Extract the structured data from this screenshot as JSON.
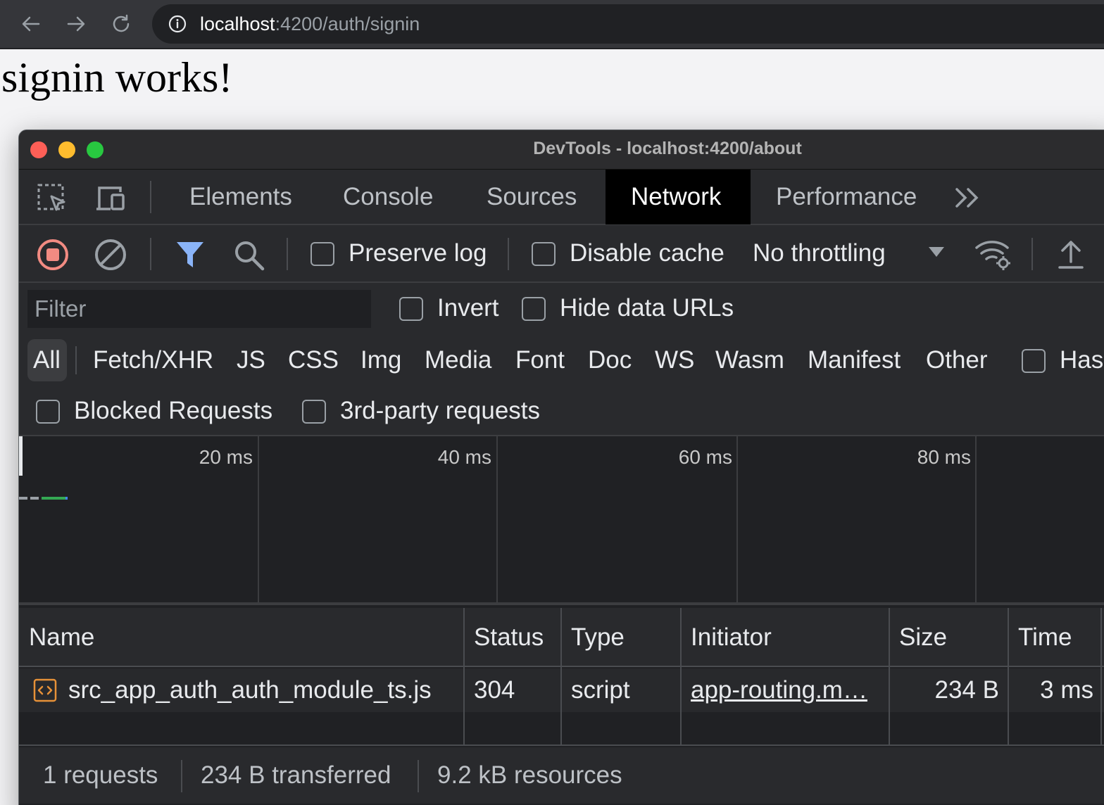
{
  "browser": {
    "url_host": "localhost",
    "url_path": ":4200/auth/signin"
  },
  "page": {
    "heading": "signin works!"
  },
  "devtools": {
    "title": "DevTools - localhost:4200/about",
    "tabs": [
      {
        "label": "Elements"
      },
      {
        "label": "Console"
      },
      {
        "label": "Sources"
      },
      {
        "label": "Network",
        "active": true
      },
      {
        "label": "Performance"
      }
    ],
    "more_tabs": "»",
    "toolbar": {
      "preserve_log": "Preserve log",
      "disable_cache": "Disable cache",
      "throttling": "No throttling"
    },
    "filter": {
      "placeholder": "Filter",
      "invert": "Invert",
      "hide_data_urls": "Hide data URLs",
      "types": [
        "All",
        "Fetch/XHR",
        "JS",
        "CSS",
        "Img",
        "Media",
        "Font",
        "Doc",
        "WS",
        "Wasm",
        "Manifest",
        "Other"
      ],
      "has_blocked_cookies": "Has",
      "blocked_requests": "Blocked Requests",
      "third_party": "3rd-party requests"
    },
    "overview": {
      "ticks": [
        "20 ms",
        "40 ms",
        "60 ms",
        "80 ms"
      ]
    },
    "table": {
      "columns": [
        "Name",
        "Status",
        "Type",
        "Initiator",
        "Size",
        "Time"
      ],
      "rows": [
        {
          "name": "src_app_auth_auth_module_ts.js",
          "status": "304",
          "type": "script",
          "initiator": "app-routing.m…",
          "size": "234 B",
          "time": "3 ms"
        }
      ]
    },
    "status": {
      "requests": "1 requests",
      "transferred": "234 B transferred",
      "resources": "9.2 kB resources"
    },
    "colors": {
      "record_red": "#f28b82",
      "filter_blue": "#8ab4f8",
      "script_orange": "#e69138",
      "waterfall_green": "#34a853"
    }
  }
}
